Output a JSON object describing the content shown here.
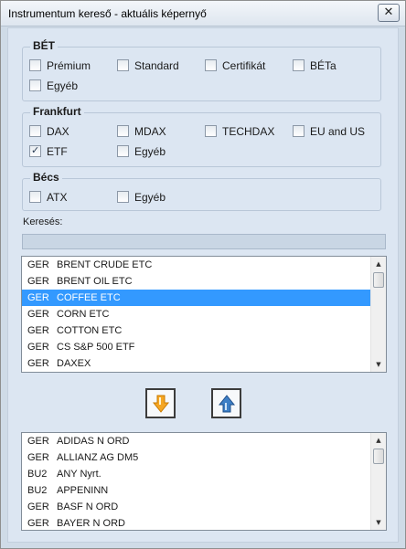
{
  "window": {
    "title": "Instrumentum kereső - aktuális képernyő",
    "close_glyph": "✕"
  },
  "groups": [
    {
      "label": "BÉT",
      "items": [
        {
          "label": "Prémium",
          "checked": false
        },
        {
          "label": "Standard",
          "checked": false
        },
        {
          "label": "Certifikát",
          "checked": false
        },
        {
          "label": "BÉTa",
          "checked": false
        },
        {
          "label": "Egyéb",
          "checked": false
        }
      ]
    },
    {
      "label": "Frankfurt",
      "items": [
        {
          "label": "DAX",
          "checked": false
        },
        {
          "label": "MDAX",
          "checked": false
        },
        {
          "label": "TECHDAX",
          "checked": false
        },
        {
          "label": "EU and US",
          "checked": false
        },
        {
          "label": "ETF",
          "checked": true
        },
        {
          "label": "Egyéb",
          "checked": false
        }
      ]
    },
    {
      "label": "Bécs",
      "items": [
        {
          "label": "ATX",
          "checked": false
        },
        {
          "label": "Egyéb",
          "checked": false
        }
      ]
    }
  ],
  "search": {
    "label": "Keresés:",
    "value": ""
  },
  "source_list": {
    "rows": [
      {
        "code": "GER",
        "name": "BRENT CRUDE ETC",
        "selected": false
      },
      {
        "code": "GER",
        "name": "BRENT OIL ETC",
        "selected": false
      },
      {
        "code": "GER",
        "name": "COFFEE ETC",
        "selected": true
      },
      {
        "code": "GER",
        "name": "CORN ETC",
        "selected": false
      },
      {
        "code": "GER",
        "name": "COTTON ETC",
        "selected": false
      },
      {
        "code": "GER",
        "name": "CS S&P 500 ETF",
        "selected": false
      },
      {
        "code": "GER",
        "name": "DAXEX",
        "selected": false
      }
    ]
  },
  "transfer": {
    "add_icon": "arrow-down-icon",
    "remove_icon": "arrow-up-icon",
    "add_color": "#f5a623",
    "remove_color": "#3d7fc6"
  },
  "target_list": {
    "rows": [
      {
        "code": "GER",
        "name": "ADIDAS N ORD",
        "selected": false
      },
      {
        "code": "GER",
        "name": "ALLIANZ AG DM5",
        "selected": false
      },
      {
        "code": "BU2",
        "name": "ANY Nyrt.",
        "selected": false
      },
      {
        "code": "BU2",
        "name": "APPENINN",
        "selected": false
      },
      {
        "code": "GER",
        "name": "BASF N ORD",
        "selected": false
      },
      {
        "code": "GER",
        "name": "BAYER N ORD",
        "selected": false
      }
    ]
  },
  "colors": {
    "selection": "#3399ff",
    "panel": "#dce6f2"
  }
}
